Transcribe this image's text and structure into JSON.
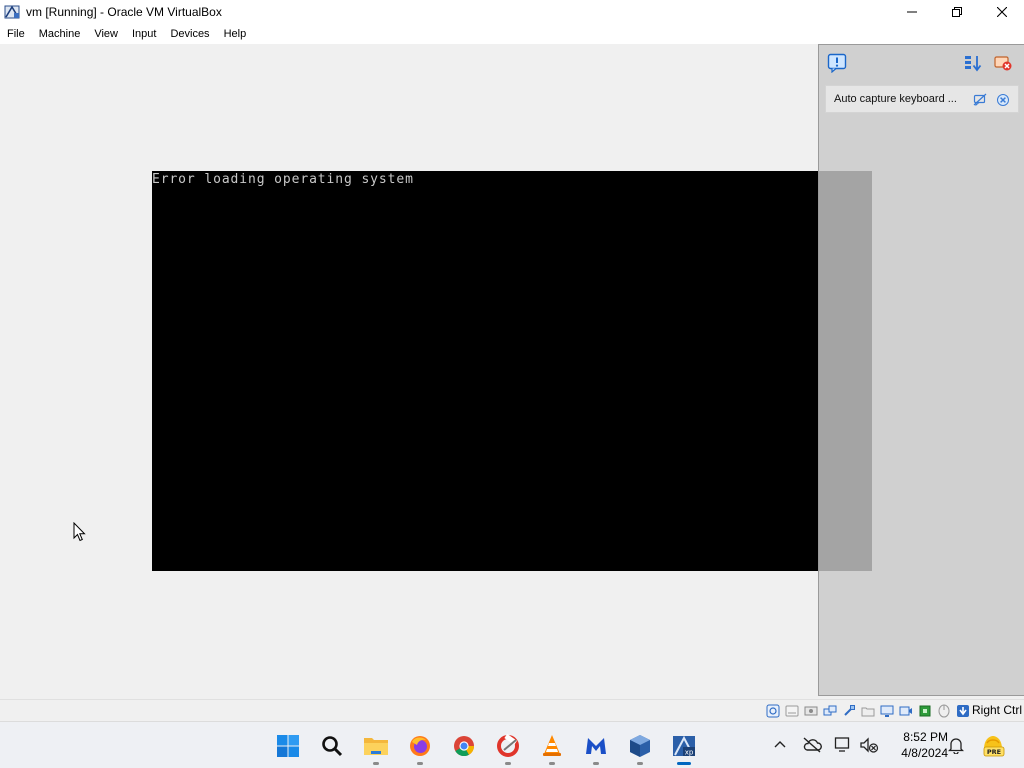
{
  "window": {
    "title": "vm [Running] - Oracle VM VirtualBox"
  },
  "menu": {
    "items": [
      "File",
      "Machine",
      "View",
      "Input",
      "Devices",
      "Help"
    ]
  },
  "vm": {
    "screen_text": "Error loading operating system"
  },
  "notification_panel": {
    "message": "Auto capture keyboard ..."
  },
  "statusbar": {
    "host_key": "Right Ctrl",
    "icons": [
      "hard-disk-icon",
      "optical-drive-icon",
      "audio-icon",
      "network-icon",
      "usb-icon",
      "shared-folders-icon",
      "display-icon",
      "recording-icon",
      "cpu-icon",
      "mouse-integration-icon",
      "keyboard-icon"
    ]
  },
  "taskbar": {
    "apps": [
      "start",
      "search",
      "file-explorer",
      "firefox",
      "chrome",
      "ccleaner",
      "vlc",
      "malwarebytes",
      "virtualbox",
      "vm-xp"
    ],
    "clock_time": "8:52 PM",
    "clock_date": "4/8/2024",
    "badge_text": "PRE"
  },
  "colors": {
    "titlebar_bg": "#ffffff",
    "client_bg": "#f0f0f0",
    "vm_bg": "#000000",
    "vm_text": "#c8c8c8",
    "accent": "#0067c0"
  }
}
